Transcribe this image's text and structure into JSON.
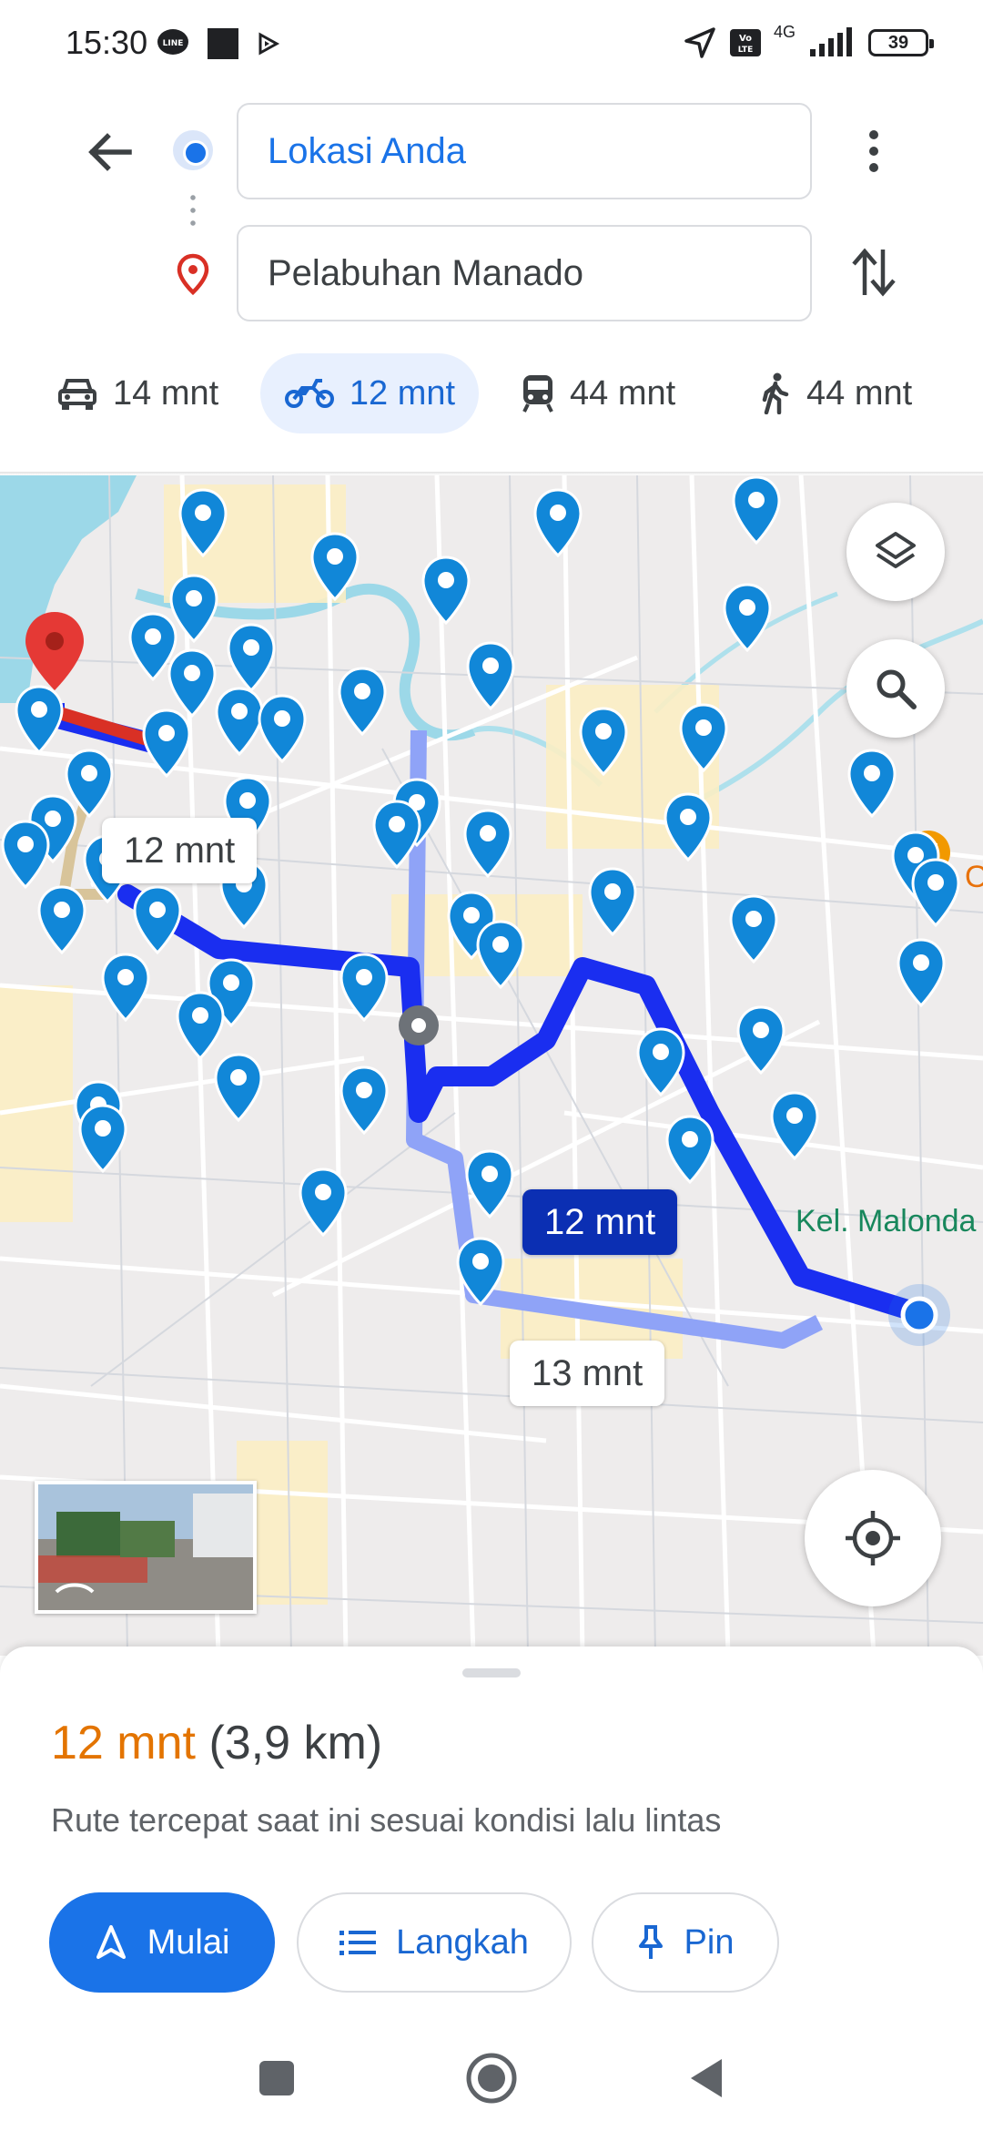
{
  "status_bar": {
    "time": "15:30",
    "battery": "39",
    "network": "4G",
    "icons": [
      "line-icon",
      "stop-icon",
      "play-icon",
      "location-arrow-icon",
      "volte-icon",
      "signal-icon",
      "battery-icon"
    ]
  },
  "directions": {
    "origin": "Lokasi Anda",
    "destination": "Pelabuhan Manado"
  },
  "modes": [
    {
      "name": "car",
      "label": "14 mnt",
      "active": false
    },
    {
      "name": "motorcycle",
      "label": "12 mnt",
      "active": true
    },
    {
      "name": "transit",
      "label": "44 mnt",
      "active": false
    },
    {
      "name": "walk",
      "label": "44 mnt",
      "active": false
    }
  ],
  "map": {
    "route_labels": [
      "12 mnt",
      "12 mnt",
      "13 mnt"
    ],
    "place_labels": [
      "Kel. Malonda",
      "O"
    ],
    "colors": {
      "route": "#1a2ef0",
      "alt_route": "#8fa3f7",
      "pin": "#1187d8",
      "destination": "#d93025"
    }
  },
  "sheet": {
    "duration": "12 mnt",
    "distance": "(3,9 km)",
    "description": "Rute tercepat saat ini sesuai kondisi lalu lintas",
    "start_label": "Mulai",
    "steps_label": "Langkah",
    "pin_label": "Pin"
  }
}
